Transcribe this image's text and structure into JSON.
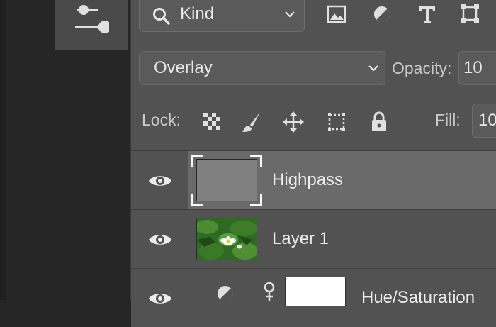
{
  "filter": {
    "kind_label": "Kind",
    "icons": [
      "image-filter-icon",
      "adjustment-filter-icon",
      "type-filter-icon",
      "shape-filter-icon"
    ]
  },
  "blend": {
    "mode": "Overlay",
    "opacity_label": "Opacity:",
    "opacity_value": "10"
  },
  "lock": {
    "label": "Lock:",
    "icons": [
      "lock-transparent-pixels-icon",
      "lock-image-pixels-icon",
      "lock-position-icon",
      "lock-artboard-icon",
      "lock-all-icon"
    ],
    "fill_label": "Fill:",
    "fill_value": "10"
  },
  "layers": [
    {
      "name": "Highpass",
      "visible": true,
      "selected": true
    },
    {
      "name": "Layer 1",
      "visible": true,
      "selected": false
    },
    {
      "name": "Hue/Saturation",
      "visible": true,
      "selected": false
    }
  ],
  "colors": {
    "panel_bg": "#525252",
    "selected_row": "#6a6a6a",
    "dark_bg": "#262626"
  }
}
